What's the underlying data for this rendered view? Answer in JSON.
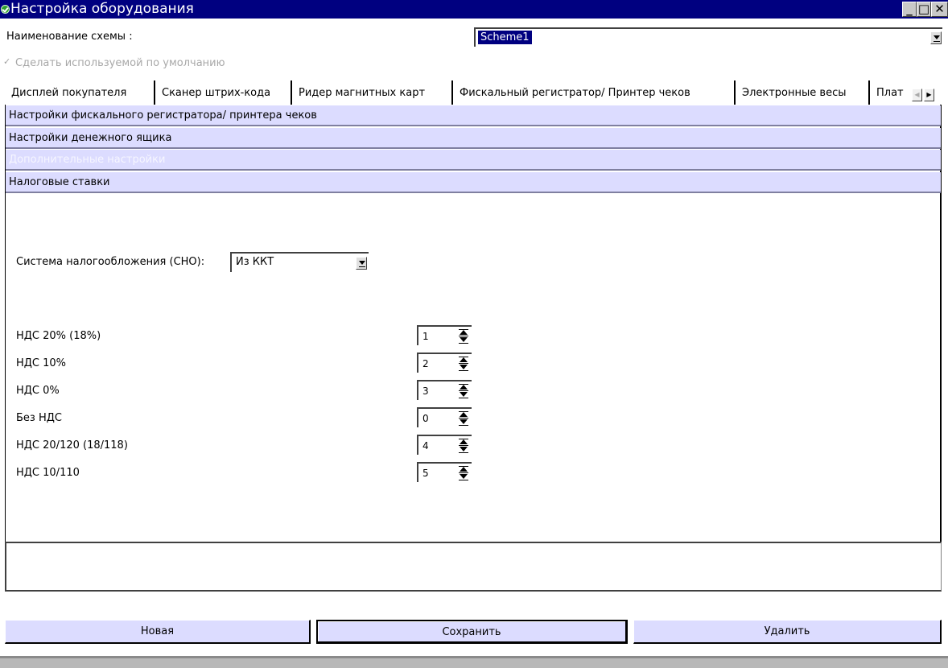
{
  "window": {
    "title": "Настройка оборудования",
    "minimize_glyph": "_",
    "maximize_glyph": "□",
    "close_glyph": "✕"
  },
  "scheme": {
    "label": "Наименование схемы :",
    "value": "Scheme1"
  },
  "default_checkbox": {
    "label": "Сделать используемой по умолчанию",
    "checked": true,
    "enabled": false,
    "glyph": "✓"
  },
  "tabs": [
    {
      "label": "Дисплей покупателя",
      "active": false
    },
    {
      "label": "Сканер штрих-кода",
      "active": false
    },
    {
      "label": "Ридер магнитных карт",
      "active": false
    },
    {
      "label": "Фискальный регистратор/ Принтер чеков",
      "active": true
    },
    {
      "label": "Электронные весы",
      "active": false
    },
    {
      "label": "Плат",
      "active": false
    }
  ],
  "tab_nav": {
    "left_glyph": "◀",
    "right_glyph": "▶"
  },
  "sections": [
    {
      "label": "Настройки фискального регистратора/ принтера чеков",
      "enabled": true
    },
    {
      "label": "Настройки денежного ящика",
      "enabled": true
    },
    {
      "label": "Дополнительные настройки",
      "enabled": false
    },
    {
      "label": "Налоговые ставки",
      "enabled": true
    }
  ],
  "tax_system": {
    "label": "Система налогообложения (СНО):",
    "value": "Из ККТ"
  },
  "vat_rates": [
    {
      "label": "НДС 20% (18%)",
      "value": "1"
    },
    {
      "label": "НДС 10%",
      "value": "2"
    },
    {
      "label": "НДС 0%",
      "value": "3"
    },
    {
      "label": "Без НДС",
      "value": "0"
    },
    {
      "label": "НДС 20/120 (18/118)",
      "value": "4"
    },
    {
      "label": "НДС 10/110",
      "value": "5"
    }
  ],
  "buttons": {
    "new": "Новая",
    "save": "Сохранить",
    "delete": "Удалить"
  },
  "colors": {
    "titlebar": "#000080",
    "section_bg": "#dcdcff",
    "button_bg": "#dcdcff",
    "disabled_text": "#a8a8a8"
  }
}
